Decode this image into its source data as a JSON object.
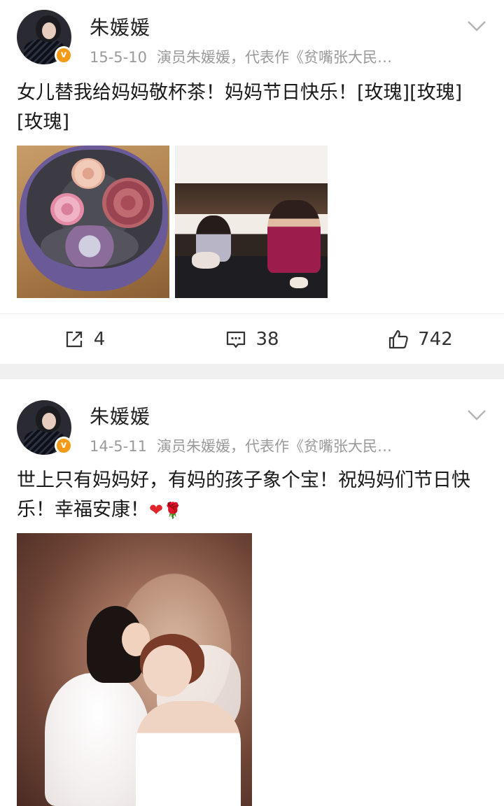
{
  "posts": [
    {
      "username": "朱媛媛",
      "badge": "v",
      "date": "15-5-10",
      "source": "演员朱媛媛，代表作《贫嘴张大民…",
      "text": "女儿替我给妈妈敬杯茶！妈妈节日快乐！[玫瑰][玫瑰][玫瑰]",
      "images": [
        "flower-box-image",
        "tea-serving-image"
      ],
      "actions": {
        "repost_icon": "repost-icon",
        "repost_count": "4",
        "comment_icon": "comment-icon",
        "comment_count": "38",
        "like_icon": "thumbs-up-icon",
        "like_count": "742"
      }
    },
    {
      "username": "朱媛媛",
      "badge": "v",
      "date": "14-5-11",
      "source": "演员朱媛媛，代表作《贫嘴张大民…",
      "text": "世上只有妈妈好，有妈的孩子象个宝！祝妈妈们节日快乐！幸福安康！",
      "emoji_heart": "❤",
      "emoji_rose": "🌹",
      "images": [
        "wedding-kiss-image"
      ]
    }
  ],
  "colors": {
    "badge": "#f39a17",
    "meta_text": "#9a9a9a",
    "divider": "#f0f0f0"
  }
}
